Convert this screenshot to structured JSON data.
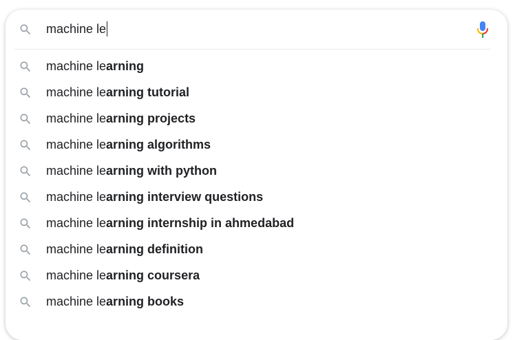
{
  "search": {
    "query": "machine le",
    "search_icon": "search-icon",
    "mic_icon": "microphone-icon"
  },
  "suggestions": [
    {
      "prefix": "machine le",
      "completion": "arning"
    },
    {
      "prefix": "machine le",
      "completion": "arning tutorial"
    },
    {
      "prefix": "machine le",
      "completion": "arning projects"
    },
    {
      "prefix": "machine le",
      "completion": "arning algorithms"
    },
    {
      "prefix": "machine le",
      "completion": "arning with python"
    },
    {
      "prefix": "machine le",
      "completion": "arning interview questions"
    },
    {
      "prefix": "machine le",
      "completion": "arning internship in ahmedabad"
    },
    {
      "prefix": "machine le",
      "completion": "arning definition"
    },
    {
      "prefix": "machine le",
      "completion": "arning coursera"
    },
    {
      "prefix": "machine le",
      "completion": "arning books"
    }
  ],
  "colors": {
    "text": "#202124",
    "icon_gray": "#9aa0a6",
    "mic_blue": "#4285f4",
    "mic_red": "#ea4335",
    "mic_yellow": "#fbbc05",
    "mic_green": "#34a853"
  }
}
